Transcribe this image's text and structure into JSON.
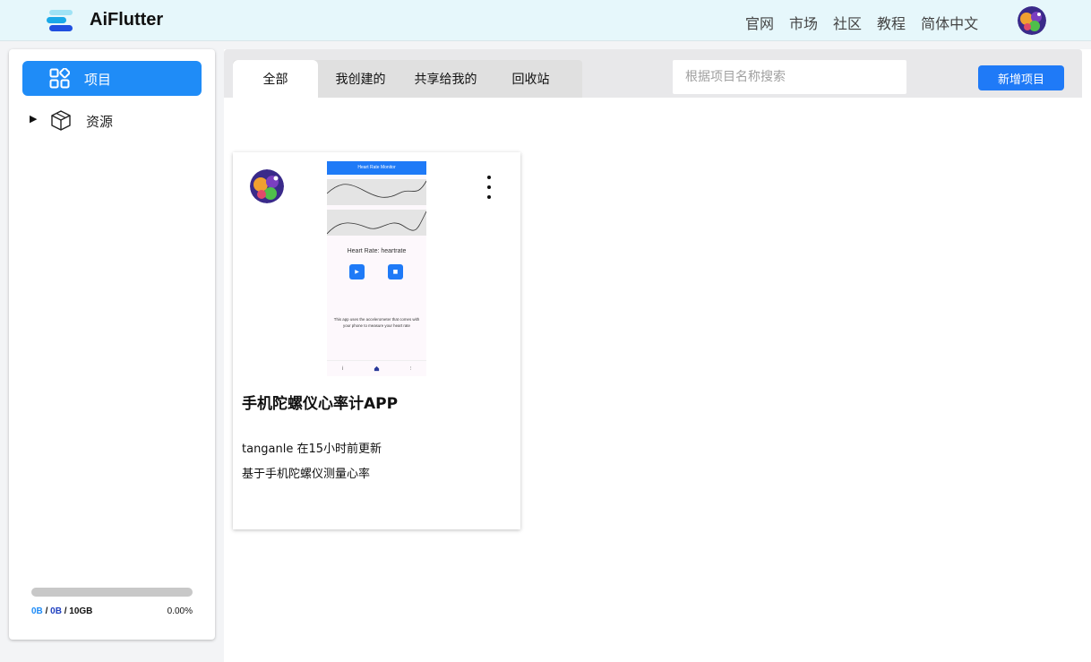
{
  "brand": {
    "name": "AiFlutter"
  },
  "nav": [
    {
      "label": "官网"
    },
    {
      "label": "市场"
    },
    {
      "label": "社区"
    },
    {
      "label": "教程"
    },
    {
      "label": "简体中文"
    }
  ],
  "sidebar": {
    "items": [
      {
        "label": "项目",
        "icon": "grid-icon",
        "active": true
      },
      {
        "label": "资源",
        "icon": "box-icon",
        "expandable": true
      }
    ],
    "storage": {
      "used": "0B",
      "used2": "0B",
      "total": "10GB",
      "separator": "/",
      "percent_label": "0.00%",
      "fraction": 0
    }
  },
  "toolbar": {
    "tabs": [
      {
        "label": "全部",
        "active": true
      },
      {
        "label": "我创建的"
      },
      {
        "label": "共享给我的"
      },
      {
        "label": "回收站"
      }
    ],
    "search_placeholder": "根据项目名称搜索",
    "new_button": "新增项目"
  },
  "projects": [
    {
      "title": "手机陀螺仪心率计APP",
      "meta": "tanganle 在15小时前更新",
      "description": "基于手机陀螺仪测量心率",
      "preview": {
        "header": "Heart Rate Monitor",
        "label": "Heart Rate: heartrate",
        "desc": "This app uses the accelerometer that comes with your phone to measure your heart rate",
        "play_glyph": "▶",
        "stop_glyph": "■"
      }
    }
  ],
  "colors": {
    "accent": "#1f8cf7",
    "button": "#1f7af7",
    "topbar": "#e6f7fb"
  }
}
